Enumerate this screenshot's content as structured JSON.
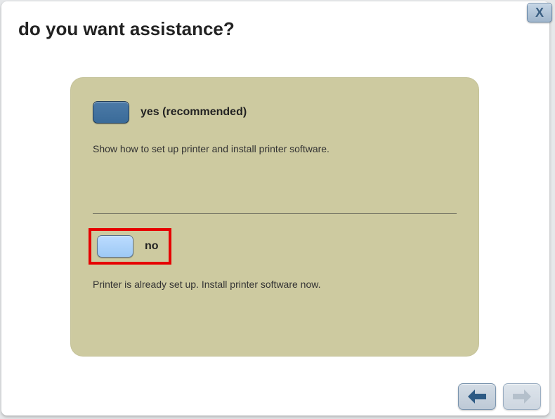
{
  "window": {
    "close_label": "X",
    "title": "do you want assistance?"
  },
  "options": {
    "yes": {
      "label": "yes (recommended)",
      "description": "Show how to set up printer and install printer software."
    },
    "no": {
      "label": "no",
      "description": "Printer is already set up. Install printer software now."
    }
  },
  "nav": {
    "back_icon": "arrow-left",
    "next_icon": "arrow-right"
  },
  "colors": {
    "panel_bg": "#cdcaa0",
    "yes_btn": "#3a6b99",
    "no_btn": "#9ec9f5",
    "highlight": "#e60000",
    "nav_arrow_active": "#2d5a84",
    "nav_arrow_disabled": "#9cabba"
  }
}
